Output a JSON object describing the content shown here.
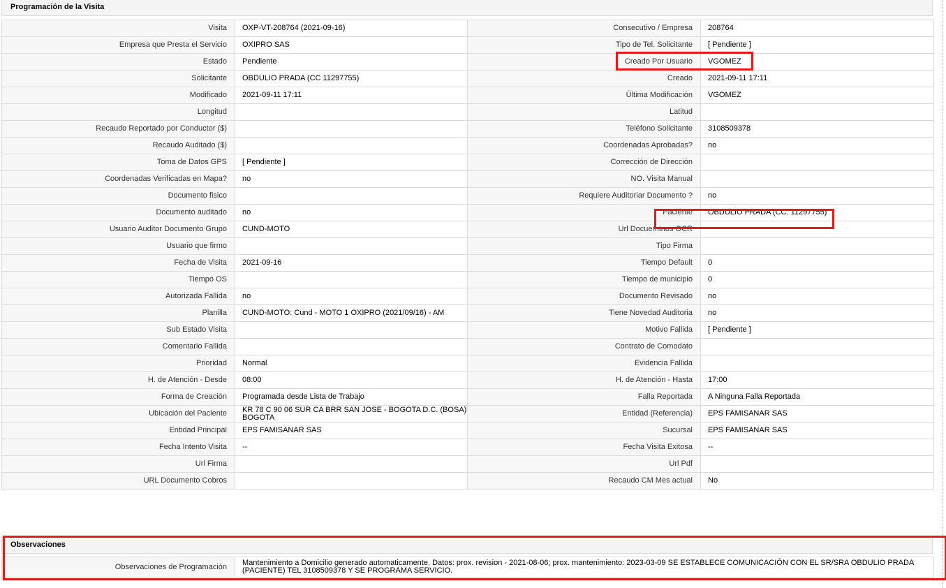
{
  "section_title": "Programación de la Visita",
  "rows": [
    {
      "l1": "Visita",
      "v1": "OXP-VT-208764 (2021-09-16)",
      "l2": "Consecutivo / Empresa",
      "v2": "208764"
    },
    {
      "l1": "Empresa que Presta el Servicio",
      "v1": "OXIPRO SAS",
      "l2": "Tipo de Tel. Solicitante",
      "v2": "[ Pendiente ]"
    },
    {
      "l1": "Estado",
      "v1": "Pendiente",
      "l2": "Creado Por Usuario",
      "v2": "VGOMEZ"
    },
    {
      "l1": "Solicitante",
      "v1": "OBDULIO PRADA (CC 11297755)",
      "l2": "Creado",
      "v2": "2021-09-11 17:11"
    },
    {
      "l1": "Modificado",
      "v1": "2021-09-11 17:11",
      "l2": "Última Modificación",
      "v2": " VGOMEZ"
    },
    {
      "l1": "Longitud",
      "v1": "",
      "l2": "Latitud",
      "v2": ""
    },
    {
      "l1": "Recaudo Reportado por Conductor ($)",
      "v1": "",
      "l2": "Teléfono Solicitante",
      "v2": "3108509378"
    },
    {
      "l1": "Recaudo Auditado ($)",
      "v1": "",
      "l2": "Coordenadas Aprobadas?",
      "v2": " no"
    },
    {
      "l1": "Toma de Datos GPS",
      "v1": "[ Pendiente ]",
      "l2": "Corrección de Dirección",
      "v2": ""
    },
    {
      "l1": "Coordenadas Verificadas en Mapa?",
      "v1": " no",
      "l2": "NO. Visita Manual",
      "v2": ""
    },
    {
      "l1": "Documento fisico",
      "v1": "",
      "l2": "Requiere Auditoriar Documento ?",
      "v2": " no"
    },
    {
      "l1": "Documento auditado",
      "v1": " no",
      "l2": "Paciente",
      "v2": "OBDULIO PRADA (CC: 11297755)"
    },
    {
      "l1": "Usuario Auditor Documento Grupo",
      "v1": "CUND-MOTO",
      "l2": "Url Docuemtnos OCR",
      "v2": ""
    },
    {
      "l1": "Usuario que firmo",
      "v1": "",
      "l2": "Tipo Firma",
      "v2": ""
    },
    {
      "l1": "Fecha de Visita",
      "v1": " 2021-09-16",
      "l2": "Tiempo Default",
      "v2": "0"
    },
    {
      "l1": "Tiempo OS",
      "v1": "",
      "l2": "Tiempo de municipio",
      "v2": "0"
    },
    {
      "l1": "Autorizada Fallida",
      "v1": " no",
      "l2": "Documento Revisado",
      "v2": " no"
    },
    {
      "l1": "Planilla",
      "v1": "CUND-MOTO: Cund - MOTO 1 OXIPRO (2021/09/16) - AM",
      "l2": "Tiene Novedad Auditoria",
      "v2": " no"
    },
    {
      "l1": "Sub Estado Visita",
      "v1": "",
      "l2": "Motivo Fallida",
      "v2": "[ Pendiente ]"
    },
    {
      "l1": "Comentario Fallida",
      "v1": "",
      "l2": "Contrato de Comodato",
      "v2": ""
    },
    {
      "l1": "Prioridad",
      "v1": "Normal",
      "l2": "Evidencia Fallida",
      "v2": ""
    },
    {
      "l1": "H. de Atención - Desde",
      "v1": "08:00",
      "l2": "H. de Atención - Hasta",
      "v2": "17:00"
    },
    {
      "l1": "Forma de Creación",
      "v1": "Programada desde Lista de Trabajo",
      "l2": "Falla Reportada",
      "v2": "A Ninguna Falla Reportada"
    },
    {
      "l1": "Ubicación del Paciente",
      "v1": "KR 78 C 90 06 SUR CA BRR SAN JOSE - BOGOTA D.C. (BOSA) BOGOTA",
      "l2": "Entidad (Referencia)",
      "v2": "EPS FAMISANAR SAS"
    },
    {
      "l1": "Entidad Principal",
      "v1": "EPS FAMISANAR SAS",
      "l2": "Sucursal",
      "v2": "EPS FAMISANAR SAS"
    },
    {
      "l1": "Fecha Intento Visita",
      "v1": " --",
      "l2": "Fecha Visita Exitosa",
      "v2": " --"
    },
    {
      "l1": "Url Firma",
      "v1": "",
      "l2": "Url Pdf",
      "v2": ""
    },
    {
      "l1": "URL Documento Cobros",
      "v1": "",
      "l2": "Recaudo CM Mes actual",
      "v2": "No"
    }
  ],
  "observaciones": {
    "title": "Observaciones",
    "label": "Observaciones de Programación",
    "value": "  Mantenimiento a Domicilio generado automaticamente. Datos: prox. revision - 2021-08-06; prox. mantenimiento: 2023-03-09 SE ESTABLECE COMUNICACIÓN CON EL SR/SRA OBDULIO PRADA (PACIENTE) TEL 3108509378 Y SE PROGRAMA SERVICIO."
  },
  "colors": {
    "highlight": "#e21b1b",
    "label_bg": "#f7f7f7",
    "border": "#dcdcdc",
    "header_bg": "#f4f4f4"
  }
}
